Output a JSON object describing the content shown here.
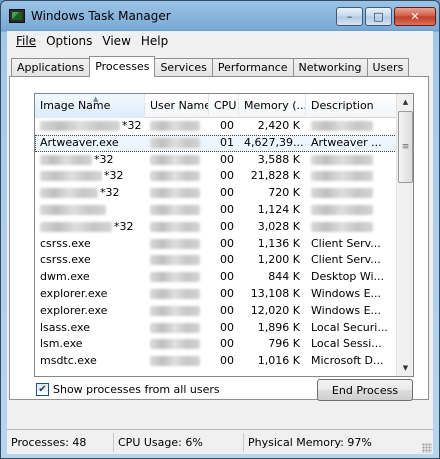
{
  "window": {
    "title": "Windows Task Manager",
    "icon": "task-manager-icon",
    "controls": {
      "minimize": "minimize-icon",
      "maximize": "maximize-icon",
      "close": "close-icon"
    }
  },
  "menu": [
    "File",
    "Options",
    "View",
    "Help"
  ],
  "tabs": [
    {
      "label": "Applications",
      "active": false
    },
    {
      "label": "Processes",
      "active": true
    },
    {
      "label": "Services",
      "active": false
    },
    {
      "label": "Performance",
      "active": false
    },
    {
      "label": "Networking",
      "active": false
    },
    {
      "label": "Users",
      "active": false
    }
  ],
  "table": {
    "columns": [
      "Image Name",
      "User Name",
      "CPU",
      "Memory (...",
      "Description"
    ],
    "sorted_column": "Image Name",
    "rows": [
      {
        "name": "",
        "name_suffix": "*32",
        "user": "",
        "cpu": "00",
        "memory": "2,420 K",
        "description": "",
        "selected": false
      },
      {
        "name": "Artweaver.exe",
        "name_suffix": "",
        "user": "",
        "cpu": "01",
        "memory": "4,627,39...",
        "description": "Artweaver ...",
        "selected": true
      },
      {
        "name": "",
        "name_suffix": "*32",
        "user": "",
        "cpu": "00",
        "memory": "3,588 K",
        "description": "",
        "selected": false
      },
      {
        "name": "",
        "name_suffix": "*32",
        "user": "",
        "cpu": "00",
        "memory": "21,828 K",
        "description": "",
        "selected": false
      },
      {
        "name": "",
        "name_suffix": "*32",
        "user": "",
        "cpu": "00",
        "memory": "720 K",
        "description": "",
        "selected": false
      },
      {
        "name": "",
        "name_suffix": "",
        "user": "",
        "cpu": "00",
        "memory": "1,124 K",
        "description": "",
        "selected": false
      },
      {
        "name": "",
        "name_suffix": "*32",
        "user": "",
        "cpu": "00",
        "memory": "3,028 K",
        "description": "",
        "selected": false
      },
      {
        "name": "csrss.exe",
        "name_suffix": "",
        "user": "",
        "cpu": "00",
        "memory": "1,136 K",
        "description": "Client Serv...",
        "selected": false
      },
      {
        "name": "csrss.exe",
        "name_suffix": "",
        "user": "",
        "cpu": "00",
        "memory": "1,200 K",
        "description": "Client Serv...",
        "selected": false
      },
      {
        "name": "dwm.exe",
        "name_suffix": "",
        "user": "",
        "cpu": "00",
        "memory": "844 K",
        "description": "Desktop Wi...",
        "selected": false
      },
      {
        "name": "explorer.exe",
        "name_suffix": "",
        "user": "",
        "cpu": "00",
        "memory": "13,108 K",
        "description": "Windows E...",
        "selected": false
      },
      {
        "name": "explorer.exe",
        "name_suffix": "",
        "user": "",
        "cpu": "00",
        "memory": "12,020 K",
        "description": "Windows E...",
        "selected": false
      },
      {
        "name": "lsass.exe",
        "name_suffix": "",
        "user": "",
        "cpu": "00",
        "memory": "1,896 K",
        "description": "Local Securi...",
        "selected": false
      },
      {
        "name": "lsm.exe",
        "name_suffix": "",
        "user": "",
        "cpu": "00",
        "memory": "796 K",
        "description": "Local Sessi...",
        "selected": false
      },
      {
        "name": "msdtc.exe",
        "name_suffix": "",
        "user": "",
        "cpu": "00",
        "memory": "1,016 K",
        "description": "Microsoft D...",
        "selected": false
      }
    ]
  },
  "show_all_users": {
    "label": "Show processes from all users",
    "checked": true
  },
  "end_process_label": "End Process",
  "status": {
    "processes": "Processes: 48",
    "cpu_usage": "CPU Usage: 6%",
    "physical_memory": "Physical Memory: 97%"
  }
}
